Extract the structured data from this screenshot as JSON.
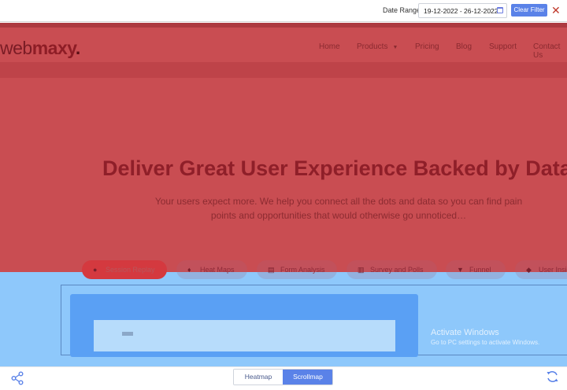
{
  "filter": {
    "label": "Date Range",
    "date_value": "19-12-2022 - 26-12-2022",
    "clear_label": "Clear Filter",
    "close_glyph": "✕"
  },
  "site": {
    "logo_part1": "web",
    "logo_part2": "maxy",
    "logo_dot": ".",
    "nav": [
      "Home",
      "Products",
      "Pricing",
      "Blog",
      "Support",
      "Contact Us"
    ],
    "headline": "Deliver Great User Experience Backed by Data",
    "sub_line1": "Your users expect more. We help you connect all the dots and data so you can find pain",
    "sub_line2": "points and opportunities that would otherwise go unnoticed…",
    "features": [
      "Session Replay",
      "Heat Maps",
      "Form Analysis",
      "Survey and Polls",
      "Funnel",
      "User Insights"
    ],
    "feature_icons": [
      "play-icon",
      "flame-icon",
      "document-icon",
      "chart-icon",
      "filter-icon",
      "users-icon"
    ]
  },
  "overlay": {
    "watermark_title": "Activate Windows",
    "watermark_sub": "Go to PC settings to activate Windows."
  },
  "toolbar": {
    "heatmap_label": "Heatmap",
    "scrollmap_label": "Scrollmap",
    "active_mode": "Scrollmap"
  },
  "colors": {
    "hot_zone": "#c94d52",
    "cool_zone": "#8ec8fb",
    "accent": "#5a82e8",
    "close": "#c0392b"
  }
}
